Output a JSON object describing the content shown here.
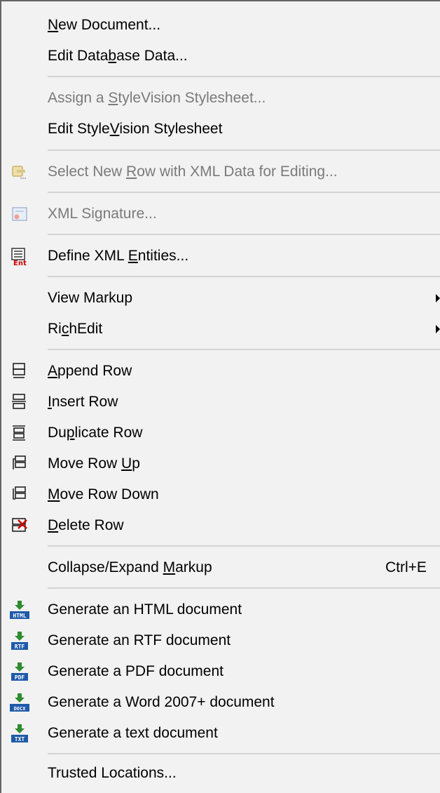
{
  "menu": {
    "items": [
      {
        "label": "New Document...",
        "accel": "N"
      },
      {
        "label": "Edit Database Data...",
        "accel": "b"
      },
      {
        "label": "Assign a StyleVision Stylesheet...",
        "accel": "S",
        "disabled": true
      },
      {
        "label": "Edit StyleVision Stylesheet",
        "accel": "V"
      },
      {
        "label": "Select New Row with XML Data for Editing...",
        "accel": "R",
        "disabled": true,
        "icon": "select-row-xml-icon"
      },
      {
        "label": "XML Signature...",
        "accel": "g",
        "disabled": true,
        "icon": "xml-signature-icon"
      },
      {
        "label": "Define XML Entities...",
        "accel": "E",
        "icon": "xml-entities-icon"
      },
      {
        "label": "View Markup",
        "submenu": true
      },
      {
        "label": "RichEdit",
        "accel": "c",
        "submenu": true
      },
      {
        "label": "Append Row",
        "accel": "A",
        "icon": "append-row-icon"
      },
      {
        "label": "Insert Row",
        "accel": "I",
        "icon": "insert-row-icon"
      },
      {
        "label": "Duplicate Row",
        "accel": "p",
        "icon": "duplicate-row-icon"
      },
      {
        "label": "Move Row Up",
        "accel": "U",
        "icon": "move-row-up-icon"
      },
      {
        "label": "Move Row Down",
        "accel": "M",
        "icon": "move-row-down-icon"
      },
      {
        "label": "Delete Row",
        "accel": "D",
        "icon": "delete-row-icon"
      },
      {
        "label": "Collapse/Expand Markup",
        "accel": "M",
        "shortcut": "Ctrl+E"
      },
      {
        "label": "Generate an HTML document",
        "icon": "generate-html-icon",
        "badge": "HTML"
      },
      {
        "label": "Generate an RTF document",
        "icon": "generate-rtf-icon",
        "badge": "RTF"
      },
      {
        "label": "Generate a PDF document",
        "icon": "generate-pdf-icon",
        "badge": "PDF"
      },
      {
        "label": "Generate a Word 2007+ document",
        "icon": "generate-docx-icon",
        "badge": "DOCX"
      },
      {
        "label": "Generate a text document",
        "icon": "generate-txt-icon",
        "badge": "TXT"
      },
      {
        "label": "Trusted Locations..."
      }
    ]
  },
  "icon_badges": {
    "entities": "Ent"
  },
  "colors": {
    "enabled_text": "#000000",
    "disabled_text": "#7a7a7a",
    "background": "#f2f2f2",
    "separator": "#d4d4d4",
    "badge_blue": "#1e5aa8",
    "arrow_green": "#2e8b2e",
    "entity_red": "#cc0000"
  }
}
